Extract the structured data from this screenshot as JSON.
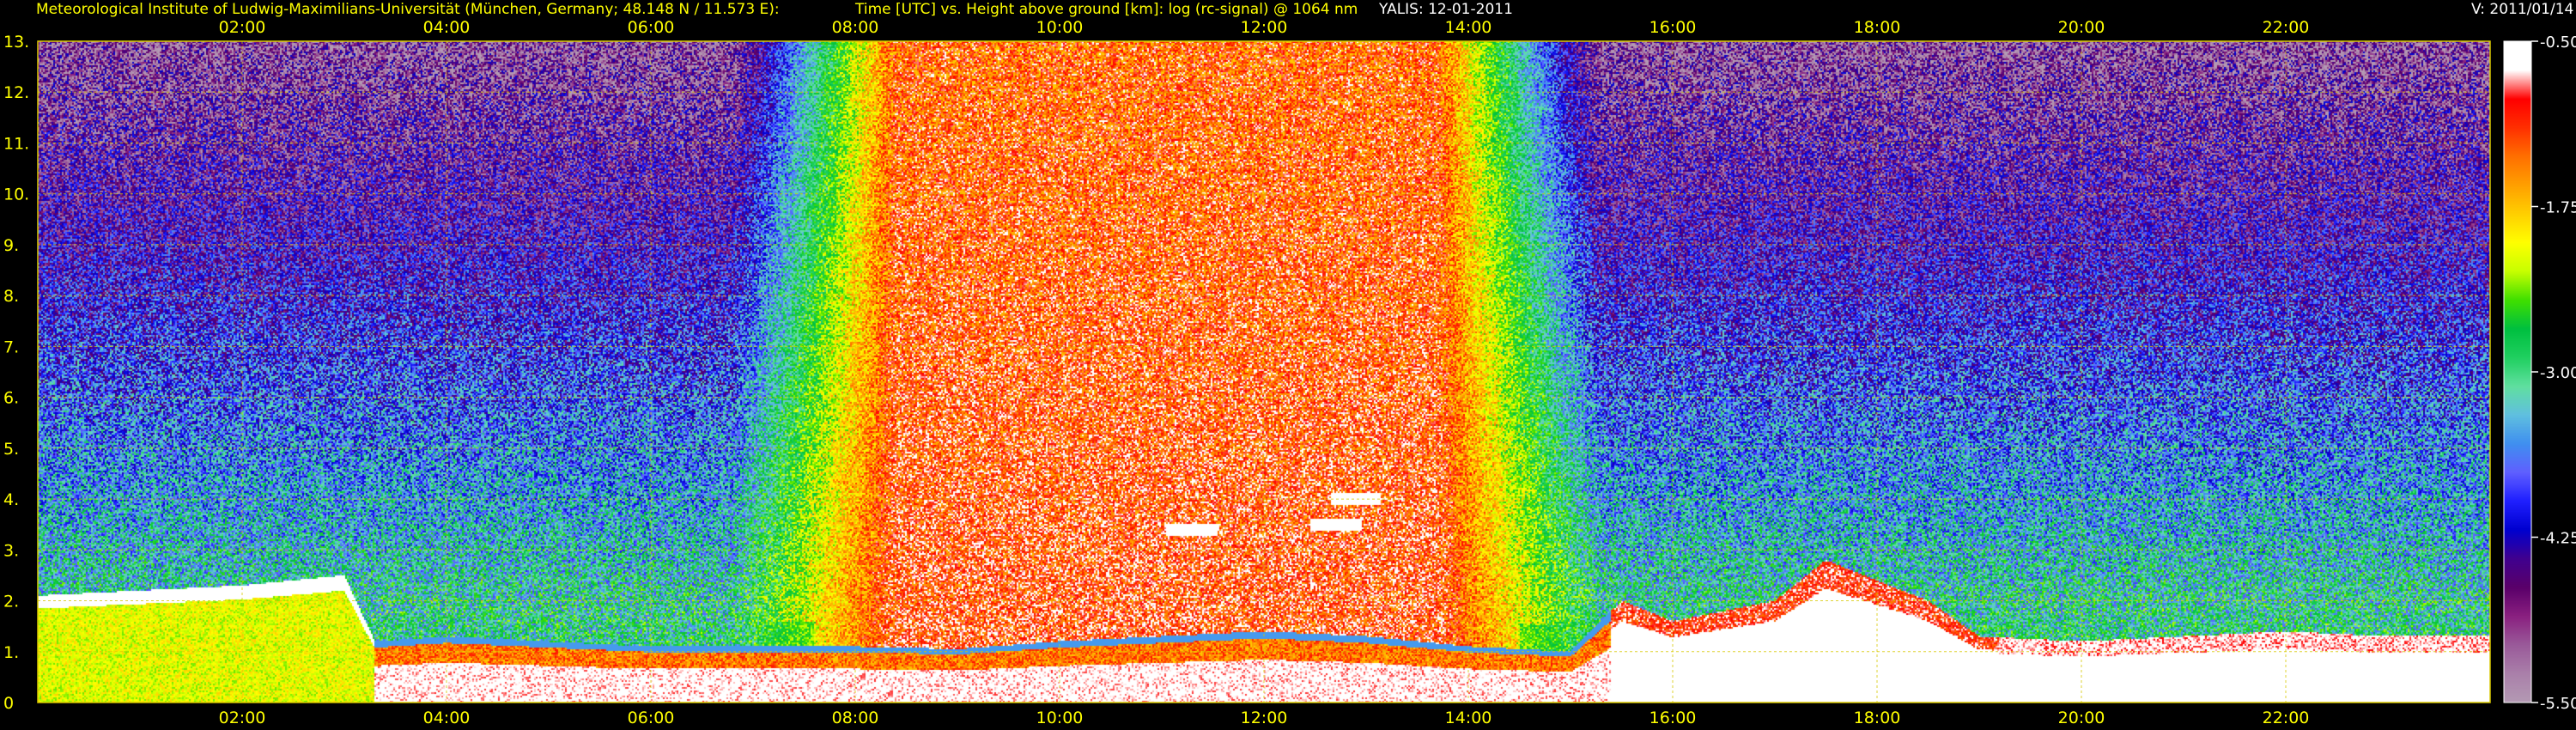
{
  "header": {
    "institute": "Meteorological Institute of Ludwig-Maximilians-Universität (München, Germany; 48.148 N / 11.573 E):",
    "plot_title": "Time [UTC] vs. Height above ground [km]: log (rc-signal) @ 1064 nm",
    "instrument_date": "YALIS: 12-01-2011",
    "version": "V: 2011/01/14"
  },
  "colors": {
    "background": "#000000",
    "header_text": "#ffff00",
    "axis_text": "#ffff00",
    "grid": "#d8c800",
    "version_text": "#ffffff"
  },
  "chart_data": {
    "type": "heatmap",
    "title": "Time [UTC] vs. Height above ground [km]: log (rc-signal) @ 1064 nm",
    "xlabel": "",
    "ylabel": "",
    "xlim": [
      0,
      24
    ],
    "ylim": [
      0,
      13
    ],
    "x_ticks": [
      "02:00",
      "04:00",
      "06:00",
      "08:00",
      "10:00",
      "12:00",
      "14:00",
      "16:00",
      "18:00",
      "20:00",
      "22:00"
    ],
    "x_tick_values": [
      2,
      4,
      6,
      8,
      10,
      12,
      14,
      16,
      18,
      20,
      22
    ],
    "y_ticks": [
      "0",
      "1.",
      "2.",
      "3.",
      "4.",
      "5.",
      "6.",
      "7.",
      "8.",
      "9.",
      "10.",
      "11.",
      "12.",
      "13."
    ],
    "y_tick_values": [
      0,
      1,
      2,
      3,
      4,
      5,
      6,
      7,
      8,
      9,
      10,
      11,
      12,
      13
    ],
    "grid": true,
    "colorbar": {
      "min": -5.5,
      "max": -0.5,
      "tick_labels": [
        "-0.50",
        "-1.75",
        "-3.00",
        "-4.25",
        "-5.50"
      ],
      "tick_values": [
        -0.5,
        -1.75,
        -3.0,
        -4.25,
        -5.5
      ],
      "colors": [
        "#ffffff",
        "#ffffff",
        "#ff0000",
        "#ff3000",
        "#ff7000",
        "#ffa000",
        "#ffd000",
        "#ffff00",
        "#c8ff00",
        "#40e000",
        "#00c040",
        "#20d060",
        "#60e0a0",
        "#60c0e0",
        "#4090f0",
        "#6060ff",
        "#2020ff",
        "#0000d0",
        "#400090",
        "#5a006a",
        "#8a2080",
        "#9a5a9a",
        "#aa80aa",
        "#b49ab4"
      ]
    },
    "boundary_layer_top_km": [
      [
        0.0,
        2.1
      ],
      [
        1.0,
        2.2
      ],
      [
        2.0,
        2.3
      ],
      [
        3.0,
        2.5
      ],
      [
        3.3,
        1.2
      ],
      [
        4.0,
        1.3
      ],
      [
        5.0,
        1.2
      ],
      [
        6.0,
        1.1
      ],
      [
        7.0,
        1.1
      ],
      [
        8.0,
        1.1
      ],
      [
        9.0,
        1.05
      ],
      [
        10.0,
        1.2
      ],
      [
        11.0,
        1.3
      ],
      [
        12.0,
        1.4
      ],
      [
        13.0,
        1.3
      ],
      [
        14.0,
        1.1
      ],
      [
        15.0,
        1.0
      ],
      [
        15.5,
        2.0
      ],
      [
        16.0,
        1.6
      ],
      [
        17.0,
        2.0
      ],
      [
        17.5,
        2.8
      ],
      [
        18.0,
        2.4
      ],
      [
        18.5,
        2.0
      ],
      [
        19.0,
        1.3
      ],
      [
        20.0,
        1.2
      ],
      [
        21.0,
        1.3
      ],
      [
        22.0,
        1.4
      ],
      [
        23.0,
        1.3
      ],
      [
        24.0,
        1.3
      ]
    ],
    "elevated_features_km": [
      {
        "x": 11.3,
        "y": 3.4
      },
      {
        "x": 12.7,
        "y": 3.5
      },
      {
        "x": 12.9,
        "y": 4.0
      }
    ]
  }
}
